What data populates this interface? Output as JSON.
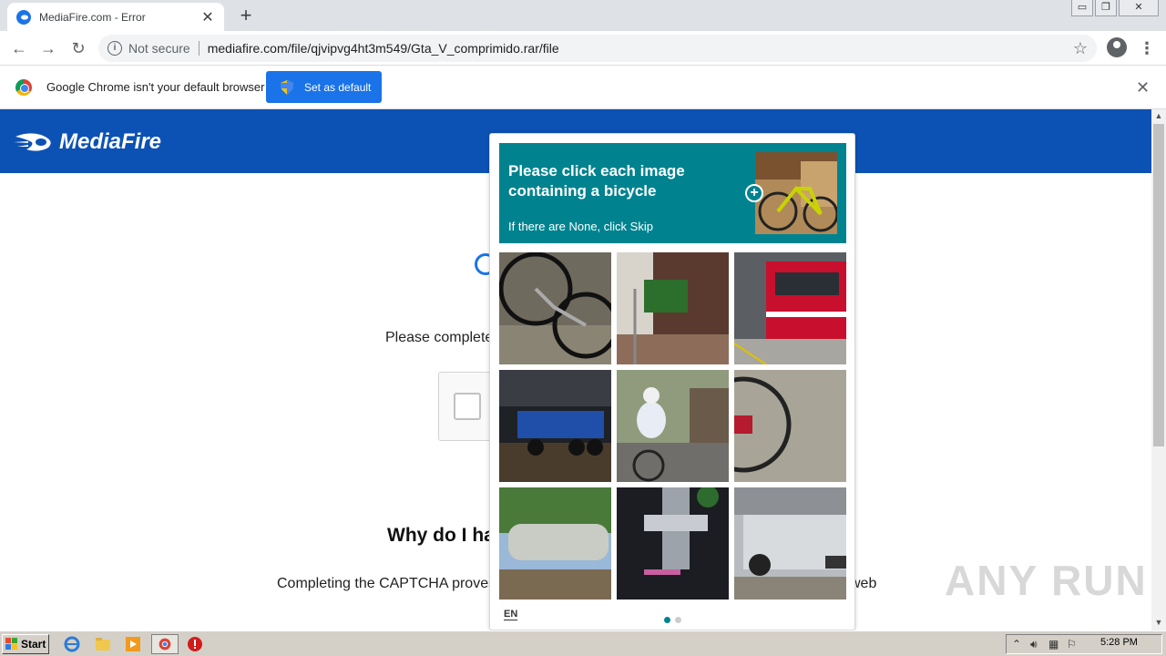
{
  "browser": {
    "tab_title": "MediaFire.com - Error",
    "new_tab_glyph": "+",
    "close_glyph": "✕",
    "security_label": "Not secure",
    "url": "mediafire.com/file/qjvipvg4ht3m549/Gta_V_comprimido.rar/file"
  },
  "infobar": {
    "message": "Google Chrome isn't your default browser",
    "button_label": "Set as default"
  },
  "page": {
    "brand": "MediaFire",
    "header_color": "#0c52b5",
    "please_text": "Please complete",
    "why_text": "Why do I ha",
    "completing_text": "Completing the CAPTCHA proves",
    "completing_end": "web"
  },
  "captcha": {
    "accent": "#00838f",
    "prompt_line": "Please click each image containing a bicycle",
    "sub_text": "If there are None, click Skip",
    "language": "EN",
    "page_dots": 2,
    "active_dot": 1,
    "tiles": [
      {
        "name": "bicycle-wheel-closeup"
      },
      {
        "name": "train-car-with-sign"
      },
      {
        "name": "red-train-at-platform"
      },
      {
        "name": "truck-pull-event"
      },
      {
        "name": "cyclist-riding"
      },
      {
        "name": "bicycle-on-ground"
      },
      {
        "name": "tanker-trailer"
      },
      {
        "name": "bicycle-frame-closeup"
      },
      {
        "name": "white-truck-trailer"
      }
    ]
  },
  "watermark": "ANY RUN",
  "taskbar": {
    "start_label": "Start",
    "clock": "5:28 PM"
  }
}
